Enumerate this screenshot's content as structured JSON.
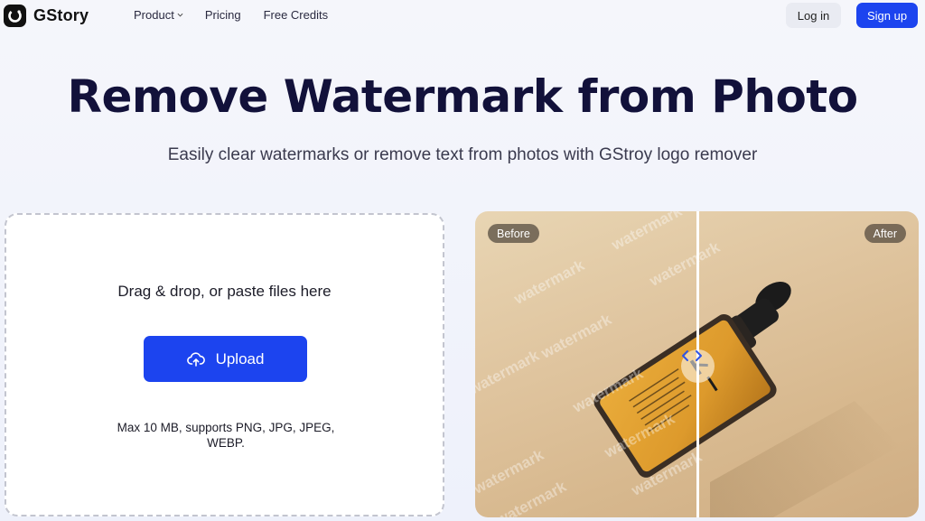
{
  "brand": {
    "name": "GStory"
  },
  "nav": {
    "product": "Product",
    "pricing": "Pricing",
    "free_credits": "Free Credits",
    "login": "Log in",
    "signup": "Sign up"
  },
  "hero": {
    "title": "Remove Watermark from Photo",
    "subtitle": "Easily clear watermarks or remove text from photos with GStroy logo remover"
  },
  "upload": {
    "drop_text": "Drag & drop, or paste files here",
    "button_label": "Upload",
    "limits_line1": "Max 10 MB, supports PNG, JPG, JPEG,",
    "limits_line2": "WEBP."
  },
  "preview": {
    "before_label": "Before",
    "after_label": "After",
    "watermark_text": "watermark",
    "product_label": "NOTICE OF BEAUTY"
  },
  "colors": {
    "accent": "#1c44ef",
    "title": "#12113a",
    "login_bg": "#e9ebf2"
  },
  "icons": {
    "logo": "gstory-logo-icon",
    "chevron": "chevron-down-icon",
    "upload": "cloud-upload-icon",
    "slider": "left-right-arrows-icon"
  }
}
